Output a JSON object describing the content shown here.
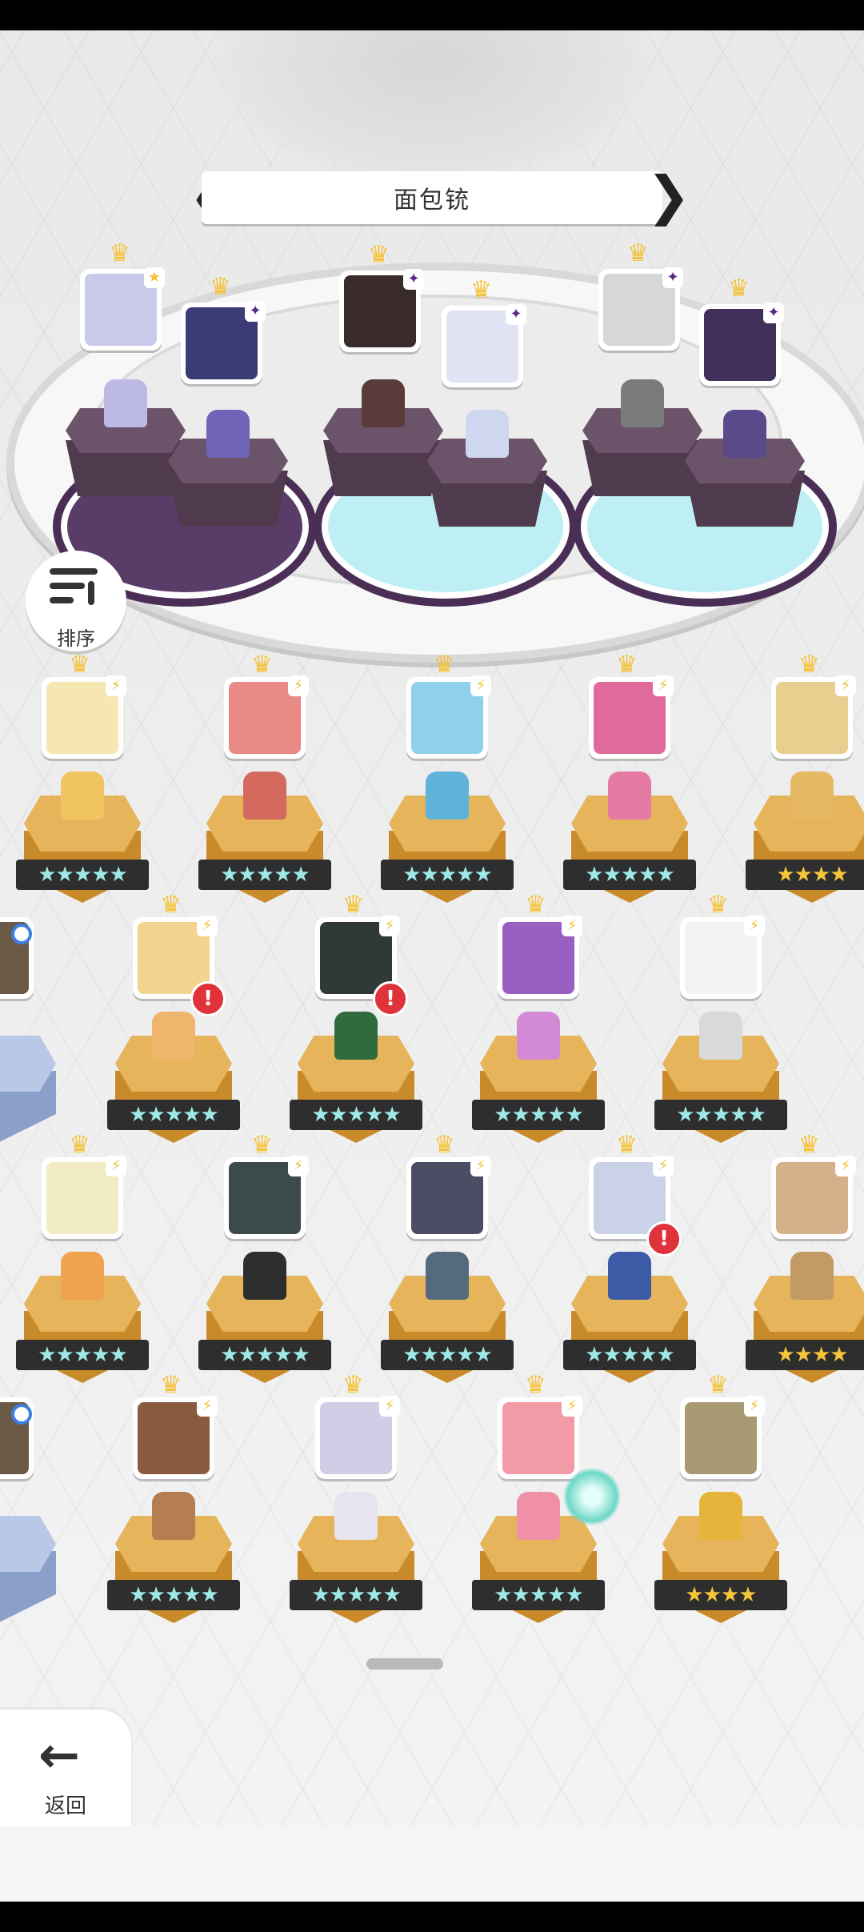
{
  "title": "面包铳",
  "sort_button": {
    "label": "排序",
    "icon": "sort-descending-icon"
  },
  "back_button": {
    "label": "返回",
    "icon": "back-arrow-icon"
  },
  "title_arrows": {
    "left": "❮",
    "right": "❯"
  },
  "star_glyph": "★",
  "top_team": [
    {
      "badge": "★",
      "badge_color": "#f1c232",
      "face": "#c9c9ea",
      "sprite": "#bcb9e6"
    },
    {
      "badge": "✦",
      "badge_color": "#5b2a86",
      "face": "#3c3b78",
      "sprite": "#6f64b8"
    },
    {
      "badge": "✦",
      "badge_color": "#5b2a86",
      "face": "#3a2b2b",
      "sprite": "#5a3a3a"
    },
    {
      "badge": "✦",
      "badge_color": "#5b2a86",
      "face": "#dfe3f4",
      "sprite": "#cfd6ef"
    },
    {
      "badge": "✦",
      "badge_color": "#5b2a86",
      "face": "#d7d7d7",
      "sprite": "#7b7b7b"
    },
    {
      "badge": "✦",
      "badge_color": "#5b2a86",
      "face": "#41305a",
      "sprite": "#5a4a8a"
    }
  ],
  "rows": [
    [
      {
        "stars": 5,
        "star_style": "cyan",
        "face": "#f6e6b0",
        "sprite": "#f0c460"
      },
      {
        "stars": 5,
        "star_style": "cyan",
        "face": "#e98a86",
        "sprite": "#d46a5e"
      },
      {
        "stars": 5,
        "star_style": "cyan",
        "face": "#8fd0ea",
        "sprite": "#5fb2d8"
      },
      {
        "stars": 5,
        "star_style": "cyan",
        "face": "#e06a9c",
        "sprite": "#e57aa5"
      },
      {
        "stars": 4,
        "star_style": "gold",
        "face": "#e8cf90",
        "sprite": "#e5b964"
      }
    ],
    [
      {
        "stars": 5,
        "star_style": "cyan",
        "face": "#f3d48e",
        "sprite": "#f0b56c",
        "alert": "!"
      },
      {
        "stars": 5,
        "star_style": "cyan",
        "face": "#2f3a38",
        "sprite": "#2f6b3e",
        "alert": "!"
      },
      {
        "stars": 5,
        "star_style": "cyan",
        "face": "#9a5fc2",
        "sprite": "#d28ad6"
      },
      {
        "stars": 5,
        "star_style": "cyan",
        "face": "#f2f2f2",
        "sprite": "#d9d9d9"
      }
    ],
    [
      {
        "stars": 5,
        "star_style": "cyan",
        "face": "#f2ecc4",
        "sprite": "#f0a34e"
      },
      {
        "stars": 5,
        "star_style": "cyan",
        "face": "#3b4a4a",
        "sprite": "#2d2d2d"
      },
      {
        "stars": 5,
        "star_style": "cyan",
        "face": "#4a4d63",
        "sprite": "#566a7e"
      },
      {
        "stars": 5,
        "star_style": "cyan",
        "face": "#c9d2e6",
        "sprite": "#3c5aa6",
        "alert": "!"
      },
      {
        "stars": 4,
        "star_style": "gold",
        "face": "#d6b08a",
        "sprite": "#c29a64"
      }
    ],
    [
      {
        "stars": 5,
        "star_style": "cyan",
        "face": "#8a5a3e",
        "sprite": "#b57e52"
      },
      {
        "stars": 5,
        "star_style": "cyan",
        "face": "#d2cde6",
        "sprite": "#e7e4f0"
      },
      {
        "stars": 5,
        "star_style": "cyan",
        "face": "#f29aa6",
        "sprite": "#f090a6"
      },
      {
        "stars": 4,
        "star_style": "gold",
        "face": "#a89b74",
        "sprite": "#e6b43a"
      }
    ]
  ]
}
